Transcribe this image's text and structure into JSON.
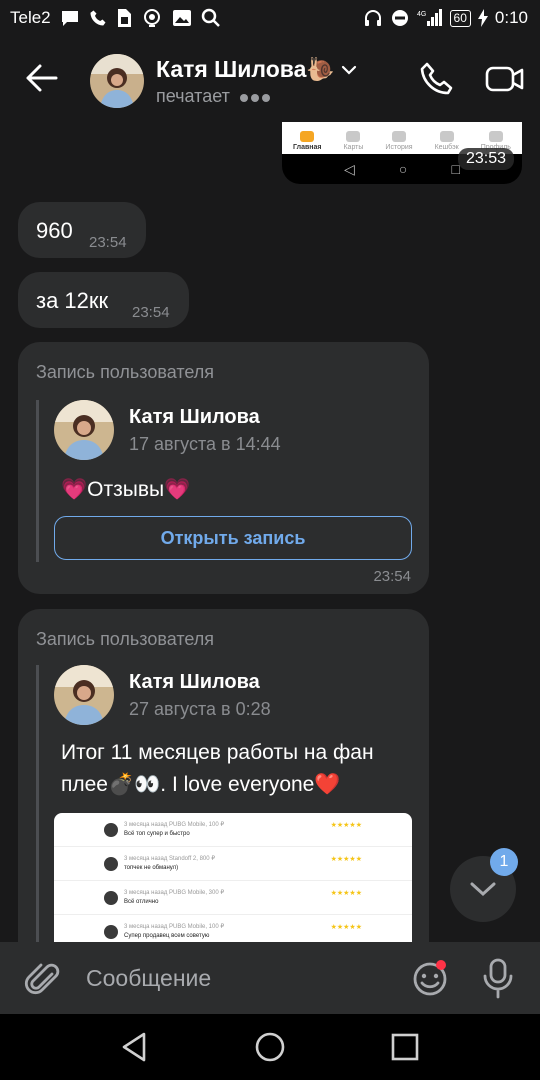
{
  "status_bar": {
    "carrier": "Tele2",
    "battery": "60",
    "time": "0:10"
  },
  "header": {
    "contact_name": "Катя Шилова🐌",
    "status": "печатает"
  },
  "screenshot_preview": {
    "tabs": [
      "Главная",
      "Карты",
      "История",
      "Кешбэк",
      "Профиль"
    ],
    "time": "23:53"
  },
  "messages": [
    {
      "text": "960",
      "time": "23:54"
    },
    {
      "text": "за 12кк",
      "time": "23:54"
    }
  ],
  "posts": [
    {
      "header": "Запись пользователя",
      "author": "Катя Шилова",
      "date": "17 августа в 14:44",
      "text": "💗Отзывы💗",
      "button": "Открыть запись",
      "time": "23:54"
    },
    {
      "header": "Запись пользователя",
      "author": "Катя Шилова",
      "date": "27 августа в 0:28",
      "text_line1": "Итог 11 месяцев работы на фан",
      "text_line2": "плее💣👀. I love everyone❤️",
      "reviews": [
        {
          "meta": "3 месяца назад   PUBG Mobile, 100 ₽",
          "text": "Всё топ супер и быстро",
          "stars": "★★★★★"
        },
        {
          "meta": "3 месяца назад   Standoff 2, 800 ₽",
          "text": "топчек не обманул)",
          "stars": "★★★★★"
        },
        {
          "meta": "3 месяца назад   PUBG Mobile, 300 ₽",
          "text": "Всё отлично",
          "stars": "★★★★★"
        },
        {
          "meta": "3 месяца назад   PUBG Mobile, 100 ₽",
          "text": "Супер продавец всем советую",
          "stars": "★★★★★"
        }
      ]
    }
  ],
  "scroll_badge": "1",
  "composer": {
    "placeholder": "Сообщение"
  },
  "colors": {
    "accent": "#71aaeb",
    "bubble": "#2c2d2e",
    "background": "#19191a",
    "emoji_dot": "#ff3347"
  }
}
